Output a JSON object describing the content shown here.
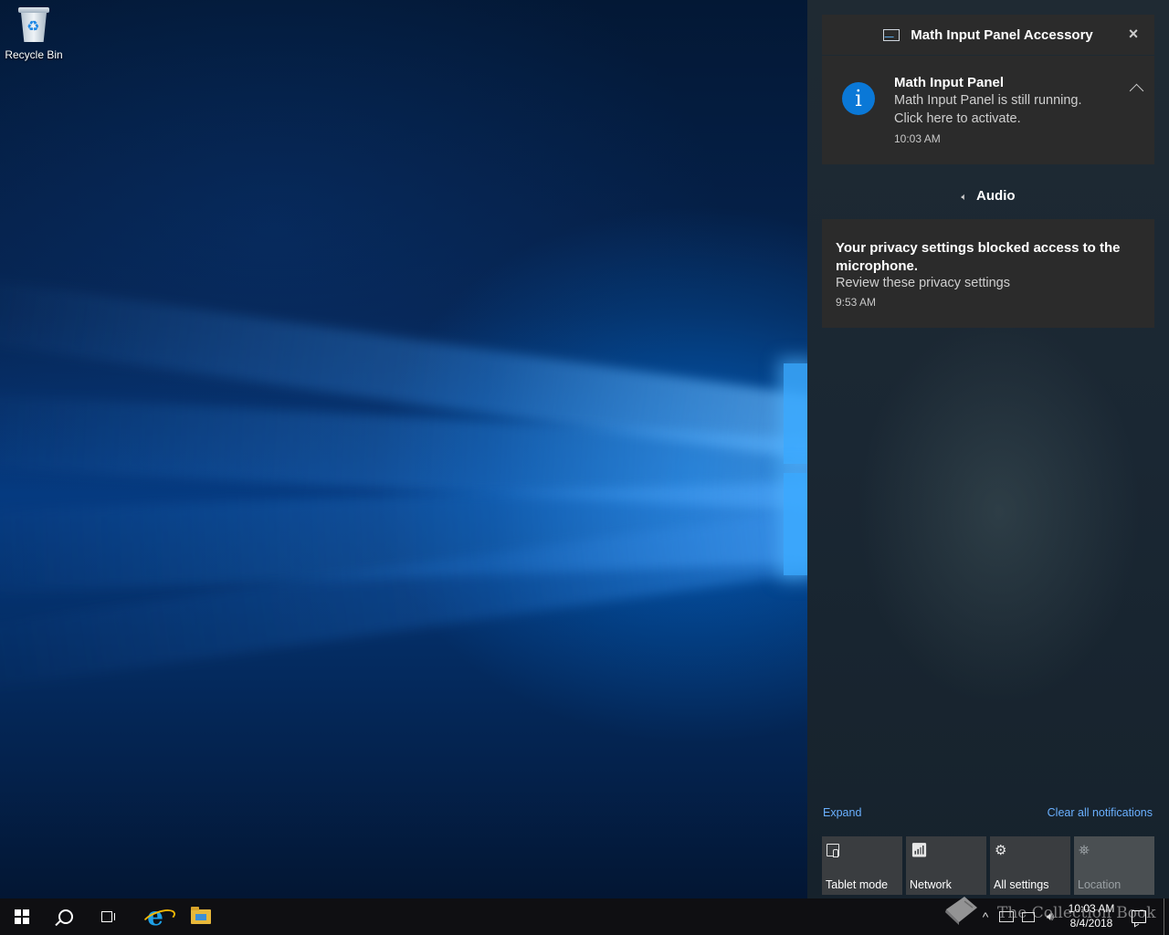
{
  "desktop": {
    "recycle_bin_label": "Recycle Bin"
  },
  "action_center": {
    "group_header": {
      "app_name": "Math Input Panel Accessory"
    },
    "toast1": {
      "title": "Math Input Panel",
      "line1": "Math Input Panel is still running.",
      "line2": "Click here to activate.",
      "time": "10:03 AM"
    },
    "audio_group": {
      "label": "Audio"
    },
    "toast2": {
      "title": "Your privacy settings blocked access to the microphone.",
      "line": "Review these privacy settings",
      "time": "9:53 AM"
    },
    "expand_label": "Expand",
    "clear_all_label": "Clear all notifications",
    "quick_actions": [
      {
        "label": "Tablet mode",
        "icon": "tablet-mode-icon"
      },
      {
        "label": "Network",
        "icon": "network-icon"
      },
      {
        "label": "All settings",
        "icon": "gear-icon"
      },
      {
        "label": "Location",
        "icon": "location-icon"
      }
    ]
  },
  "taskbar": {
    "clock_time": "10:03 AM",
    "clock_date": "8/4/2018"
  },
  "watermark": {
    "text": "The Collection Book"
  },
  "colors": {
    "accent": "#0a78d7",
    "link": "#6ab0ff",
    "toast_bg": "#2b2b2b",
    "tile_bg": "#3a3d40",
    "taskbar_bg": "#0f0f12"
  }
}
